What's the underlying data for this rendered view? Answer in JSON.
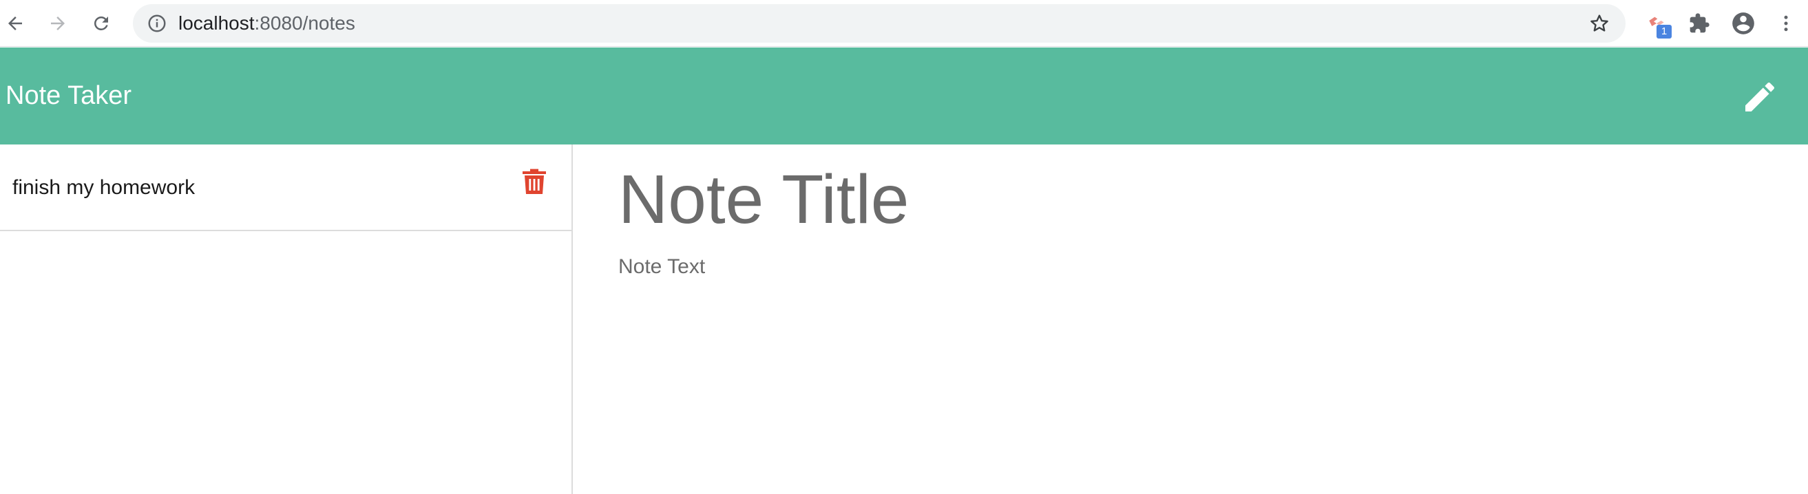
{
  "browser": {
    "url_host": "localhost",
    "url_path": ":8080/notes",
    "extension_badge": "1"
  },
  "app": {
    "brand": "Note Taker"
  },
  "notes": [
    {
      "title": "finish my homework"
    }
  ],
  "editor": {
    "title_placeholder": "Note Title",
    "text_placeholder": "Note Text"
  },
  "colors": {
    "navbar": "#58bb9e",
    "delete": "#e0442f",
    "placeholder": "#6b6b6b"
  }
}
